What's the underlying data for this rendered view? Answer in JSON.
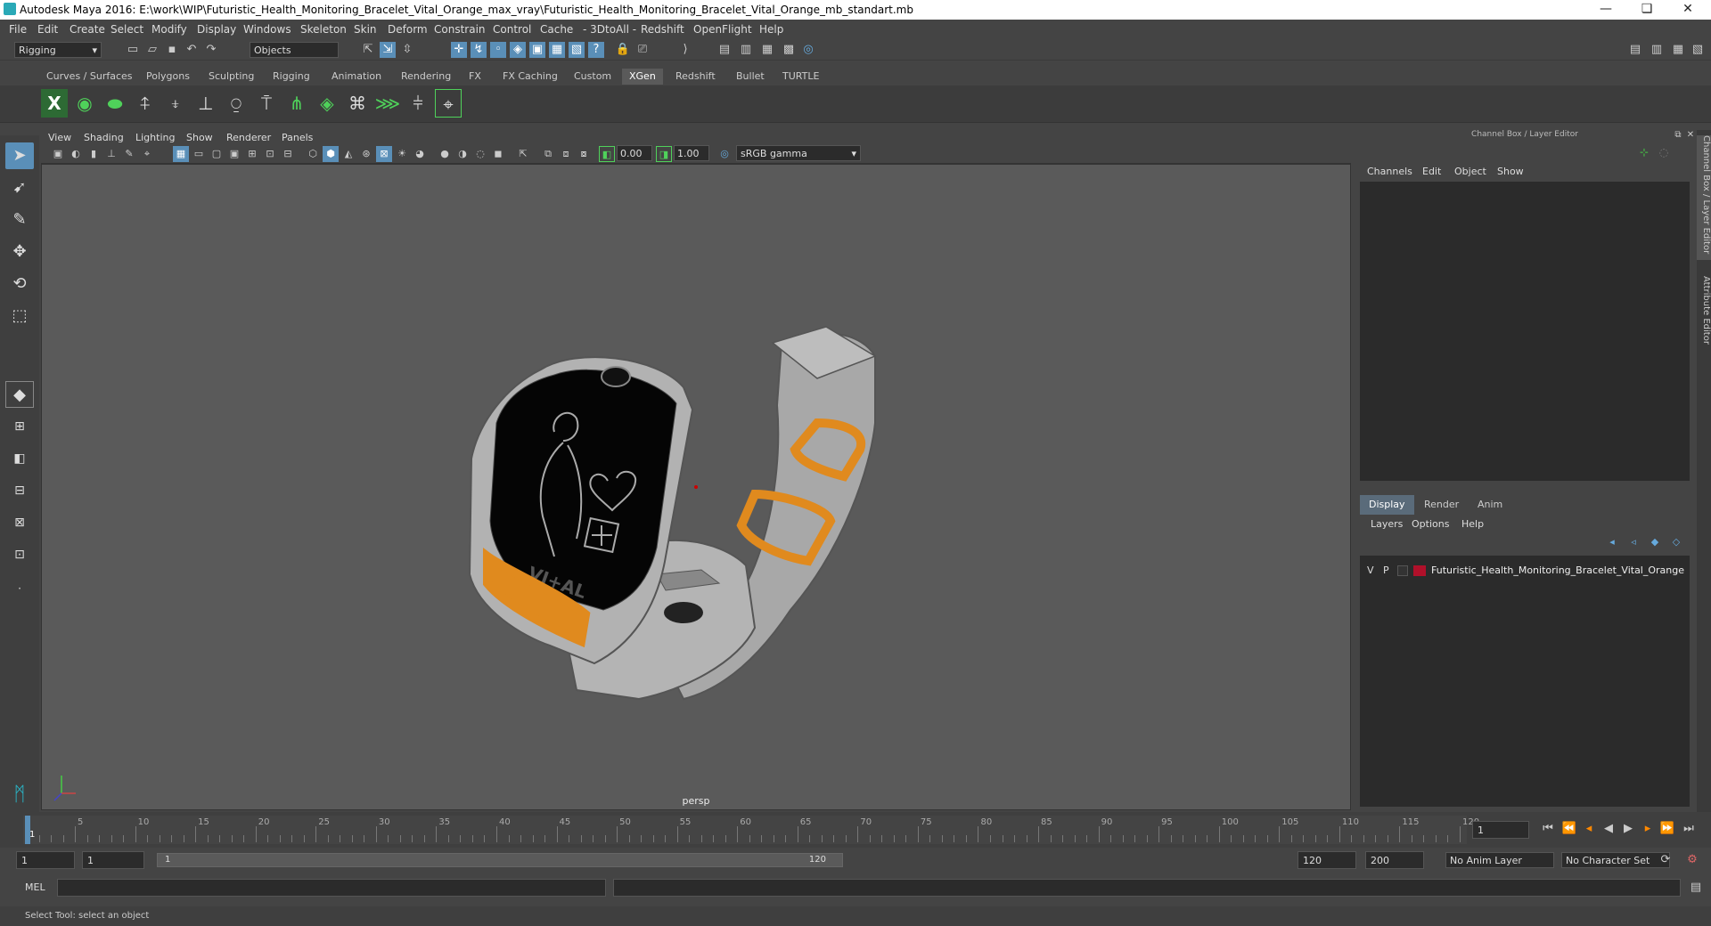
{
  "window": {
    "title": "Autodesk Maya 2016: E:\\work\\WIP\\Futuristic_Health_Monitoring_Bracelet_Vital_Orange_max_vray\\Futuristic_Health_Monitoring_Bracelet_Vital_Orange_mb_standart.mb",
    "minimize": "—",
    "restore": "❏",
    "close": "✕"
  },
  "menubar": [
    "File",
    "Edit",
    "Create",
    "Select",
    "Modify",
    "Display",
    "Windows",
    "Skeleton",
    "Skin",
    "Deform",
    "Constrain",
    "Control",
    "Cache",
    "- 3DtoAll -",
    "Redshift",
    "OpenFlight",
    "Help"
  ],
  "statusline": {
    "mode": "Rigging",
    "selection_mode": "Objects"
  },
  "shelf_tabs": [
    "Curves / Surfaces",
    "Polygons",
    "Sculpting",
    "Rigging",
    "Animation",
    "Rendering",
    "FX",
    "FX Caching",
    "Custom",
    "XGen",
    "Redshift",
    "Bullet",
    "TURTLE"
  ],
  "active_shelf": "XGen",
  "viewport": {
    "menu": [
      "View",
      "Shading",
      "Lighting",
      "Show",
      "Renderer",
      "Panels"
    ],
    "exposure": "0.00",
    "gamma": "1.00",
    "color_space": "sRGB gamma",
    "camera_label": "persp",
    "screen_text": "VI+AL"
  },
  "channel_box": {
    "title": "Channel Box / Layer Editor",
    "menu": [
      "Channels",
      "Edit",
      "Object",
      "Show"
    ]
  },
  "layer_editor": {
    "tabs": [
      "Display",
      "Render",
      "Anim"
    ],
    "active_tab": "Display",
    "menu": [
      "Layers",
      "Options",
      "Help"
    ],
    "layers": [
      {
        "v": "V",
        "p": "P",
        "name": "Futuristic_Health_Monitoring_Bracelet_Vital_Orange",
        "color": "#b0102a"
      }
    ]
  },
  "side_tabs": [
    "Channel Box / Layer Editor",
    "Attribute Editor"
  ],
  "timeline": {
    "labels": [
      "1",
      "5",
      "10",
      "15",
      "20",
      "25",
      "30",
      "35",
      "40",
      "45",
      "50",
      "55",
      "60",
      "65",
      "70",
      "75",
      "80",
      "85",
      "90",
      "95",
      "100",
      "105",
      "110",
      "115",
      "120"
    ],
    "current_frame": "1"
  },
  "range": {
    "start": "1",
    "playback_start": "1",
    "slider_start": "1",
    "slider_end": "120",
    "playback_end": "120",
    "end": "200",
    "anim_layer": "No Anim Layer",
    "character_set": "No Character Set"
  },
  "command_line": {
    "label": "MEL"
  },
  "help_line": "Select Tool: select an object"
}
